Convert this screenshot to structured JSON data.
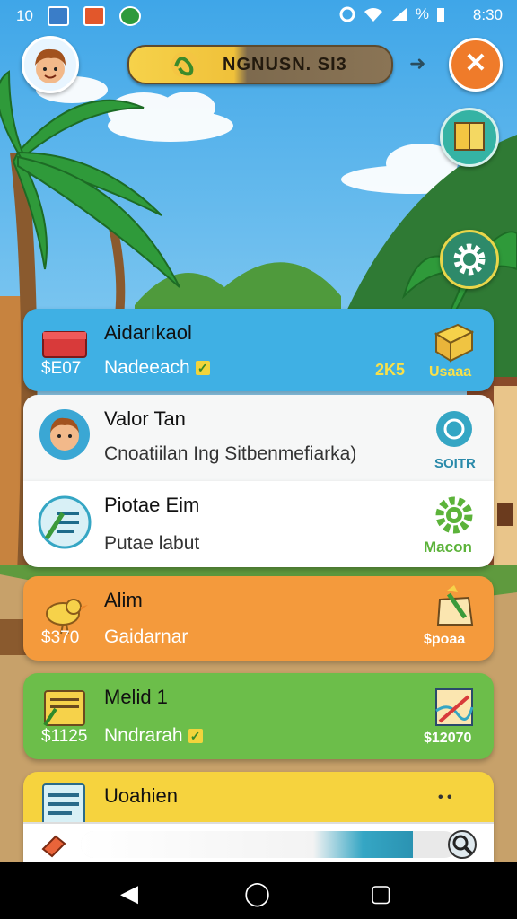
{
  "status_bar": {
    "left_text": "10",
    "battery_pct_symbol": "%",
    "time": "8:30"
  },
  "header": {
    "title": "NGNUSN. SI3",
    "close_symbol": "✕",
    "arrow_symbol": "➜"
  },
  "icons": {
    "avatar": "avatar-boy-icon",
    "title_badge": "pretzel-badge-icon",
    "book": "book-icon",
    "settings": "gear-icon"
  },
  "cards": [
    {
      "title": "Aidarıkaol",
      "price": "$E07",
      "subtitle": "Nadeeach",
      "right_value": "2K5",
      "right_label": "Usaaa",
      "color": "#3fb0e4"
    },
    {
      "title": "Valor Tan",
      "subtitle": "Cnoatiilan Ing Sitbenmefiarka)",
      "right_label": "SOITR",
      "color": "#f6f7f7"
    },
    {
      "title": "Piotae Eim",
      "subtitle": "Putae labut",
      "right_label": "Macon",
      "color": "#ffffff"
    },
    {
      "title": "Alim",
      "price": "$370",
      "subtitle": "Gaidarnar",
      "right_label": "$poaa",
      "color": "#f49a3c"
    },
    {
      "title": "Melid 1",
      "price": "$1125",
      "subtitle": "Nndrarah",
      "right_label": "$12070",
      "color": "#6cbe4a"
    },
    {
      "title": "Uoahien",
      "right_label": "• •",
      "color": "#f6d33e"
    }
  ],
  "progress": {
    "fraction": 0.88
  },
  "nav": {
    "back": "◀",
    "home": "◯",
    "recents": "▢"
  }
}
